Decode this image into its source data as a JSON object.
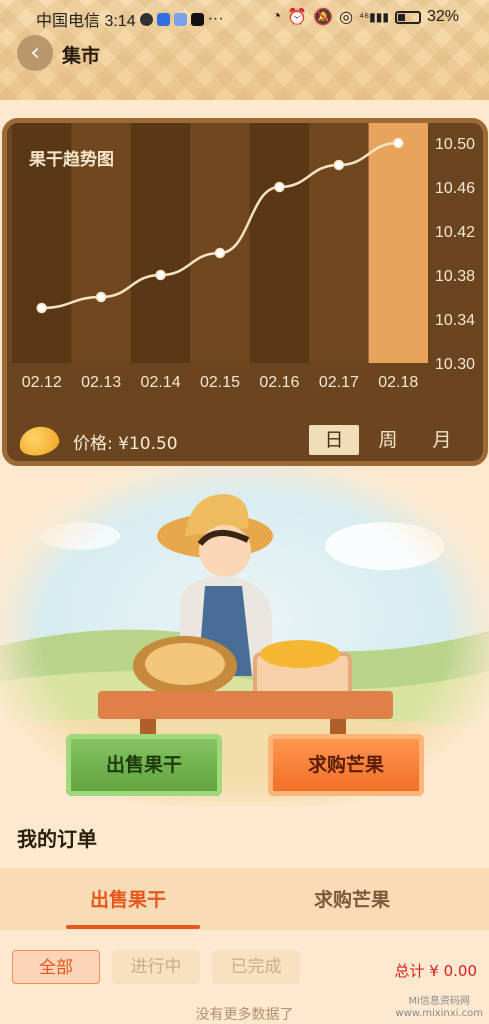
{
  "status_bar": {
    "carrier_time": "中国电信 3:14",
    "dots": "···",
    "network": "⁴⁶",
    "battery": "32%"
  },
  "header": {
    "back_icon": "chevron-left-icon",
    "title": "集市"
  },
  "chart_card": {
    "title": "果干趋势图",
    "price_label": "价格: ¥10.50",
    "tabs": [
      "日",
      "周",
      "月"
    ],
    "active_tab": "日"
  },
  "chart_data": {
    "type": "line",
    "title": "果干趋势图",
    "categories": [
      "02.12",
      "02.13",
      "02.14",
      "02.15",
      "02.16",
      "02.17",
      "02.18"
    ],
    "values": [
      10.35,
      10.36,
      10.38,
      10.4,
      10.46,
      10.48,
      10.5
    ],
    "ylim": [
      10.3,
      10.5
    ],
    "y_ticks": [
      "10.50",
      "10.46",
      "10.42",
      "10.38",
      "10.34",
      "10.30"
    ],
    "highlight_category": "02.18",
    "colors": {
      "line": "#f6e3c4",
      "highlight": "#e8a35c",
      "band_dark": "#5a3816",
      "band_light": "#70471f"
    }
  },
  "actions": {
    "sell_label": "出售果干",
    "buy_label": "求购芒果"
  },
  "orders": {
    "title": "我的订单",
    "tabs": [
      "出售果干",
      "求购芒果"
    ],
    "filters": [
      "全部",
      "进行中",
      "已完成"
    ],
    "total": "总计 ¥ 0.00",
    "empty_text": "没有更多数据了"
  },
  "watermark": {
    "line1": "Mi信息资码网",
    "line2": "www.mixinxi.com"
  }
}
